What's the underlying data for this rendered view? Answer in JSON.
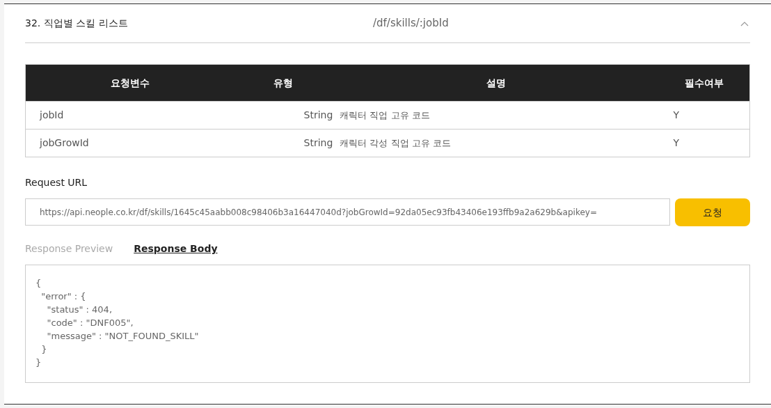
{
  "header": {
    "title": "32. 직업별 스킬 리스트",
    "endpoint": "/df/skills/:jobId",
    "expanded": true
  },
  "table": {
    "columns": [
      "요청변수",
      "유형",
      "설명",
      "필수여부"
    ],
    "rows": [
      [
        "jobId",
        "String",
        "캐릭터 직업 고유 코드",
        "Y"
      ],
      [
        "jobGrowId",
        "String",
        "캐릭터 각성 직업 고유 코드",
        "Y"
      ]
    ]
  },
  "request": {
    "label": "Request URL",
    "value": "https://api.neople.co.kr/df/skills/1645c45aabb008c98406b3a16447040d?jobGrowId=92da05ec93fb43406e193ffb9a2a629b&apikey=",
    "button": "요청"
  },
  "response_tabs": [
    {
      "label": "Response Preview",
      "selected": false
    },
    {
      "label": "Response Body",
      "selected": true
    }
  ],
  "response_body": "{\n  \"error\" : {\n    \"status\" : 404,\n    \"code\" : \"DNF005\",\n    \"message\" : \"NOT_FOUND_SKILL\"\n  }\n}"
}
